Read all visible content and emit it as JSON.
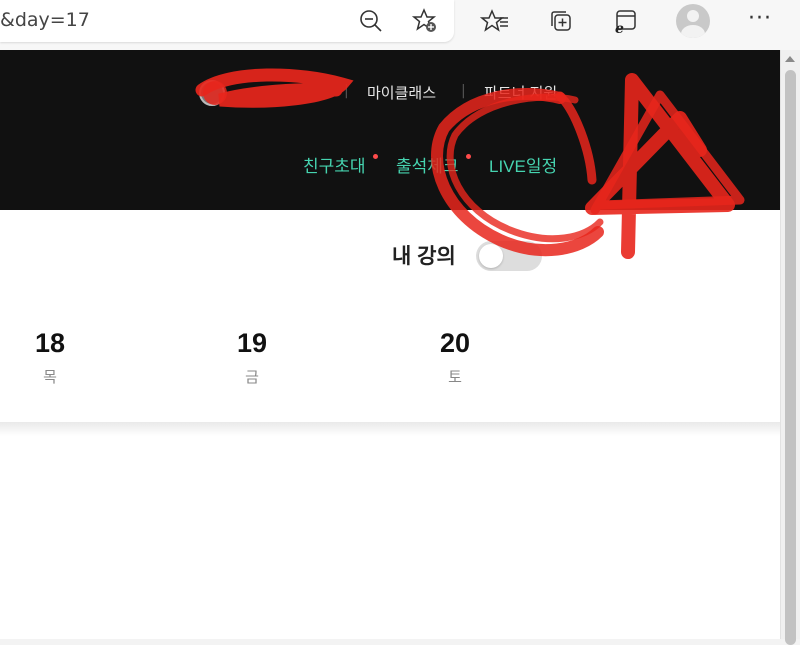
{
  "browser": {
    "url_text": "&day=17",
    "icons": [
      "zoom-out-icon",
      "add-favorite-icon",
      "favorites-icon",
      "collections-icon",
      "ie-mode-icon",
      "profile-icon",
      "more-icon"
    ],
    "more_label": "···"
  },
  "header": {
    "nav": {
      "my_class": "마이클래스",
      "partner_support": "파트너 지원"
    },
    "separator": "|",
    "links": {
      "invite_friends": "친구초대",
      "attendance": "출석체크",
      "live_schedule": "LIVE일정"
    }
  },
  "main": {
    "title": "내 강의",
    "calendar": [
      {
        "day": "18",
        "weekday": "목"
      },
      {
        "day": "19",
        "weekday": "금"
      },
      {
        "day": "20",
        "weekday": "토"
      }
    ]
  },
  "colors": {
    "header_bg": "#111111",
    "link_green": "#46d4b0",
    "notice_dot": "#ff4b4b",
    "annotation_red": "#e8261c"
  }
}
